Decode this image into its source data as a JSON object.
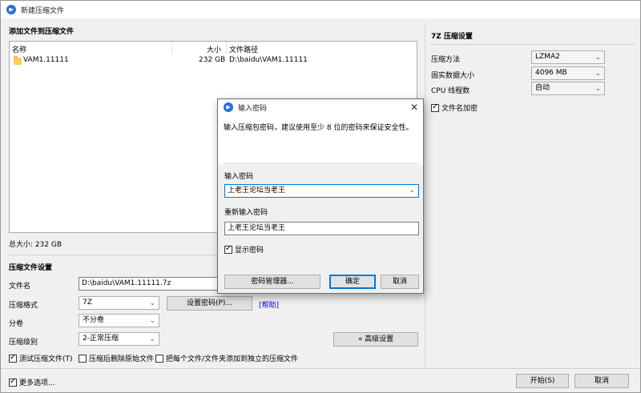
{
  "window": {
    "title": "新建压缩文件"
  },
  "files": {
    "section_title": "添加文件到压缩文件",
    "columns": {
      "name": "名称",
      "size": "大小",
      "path": "文件路径"
    },
    "rows": [
      {
        "name": "VAM1.11111",
        "size": "232 GB",
        "path": "D:\\baidu\\VAM1.11111"
      }
    ],
    "total": "总大小: 232 GB"
  },
  "settings": {
    "section_title": "压缩文件设置",
    "filename_label": "文件名",
    "filename_value": "D:\\baidu\\VAM1.11111.7z",
    "format_label": "压缩格式",
    "format_value": "7Z",
    "set_password_button": "设置密码(P)...",
    "help_link": "[帮助]",
    "volume_label": "分卷",
    "volume_value": "不分卷",
    "level_label": "压缩级别",
    "level_value": "2-正常压缩",
    "advanced_button": "« 高级设置",
    "test_label": "测试压缩文件(T)",
    "delete_label": "压缩后删除原始文件",
    "separate_label": "把每个文件/文件夹添加到独立的压缩文件"
  },
  "seven_z": {
    "section_title": "7Z 压缩设置",
    "method_label": "压缩方法",
    "method_value": "LZMA2",
    "solid_label": "固实数据大小",
    "solid_value": "4096 MB",
    "threads_label": "CPU 线程数",
    "threads_value": "自动",
    "encrypt_names_label": "文件名加密"
  },
  "footer": {
    "more_options_label": "更多选项...",
    "start_button": "开始(S)",
    "cancel_button": "取消"
  },
  "password_dialog": {
    "title": "输入密码",
    "hint": "输入压缩包密码，建议使用至少 8 位的密码来保证安全性。",
    "password_label": "输入密码",
    "password_value": "上老王论坛当老王",
    "confirm_label": "重新输入密码",
    "confirm_value": "上老王论坛当老王",
    "show_password_label": "显示密码",
    "manager_button": "密码管理器...",
    "ok_button": "确定",
    "cancel_button": "取消"
  }
}
